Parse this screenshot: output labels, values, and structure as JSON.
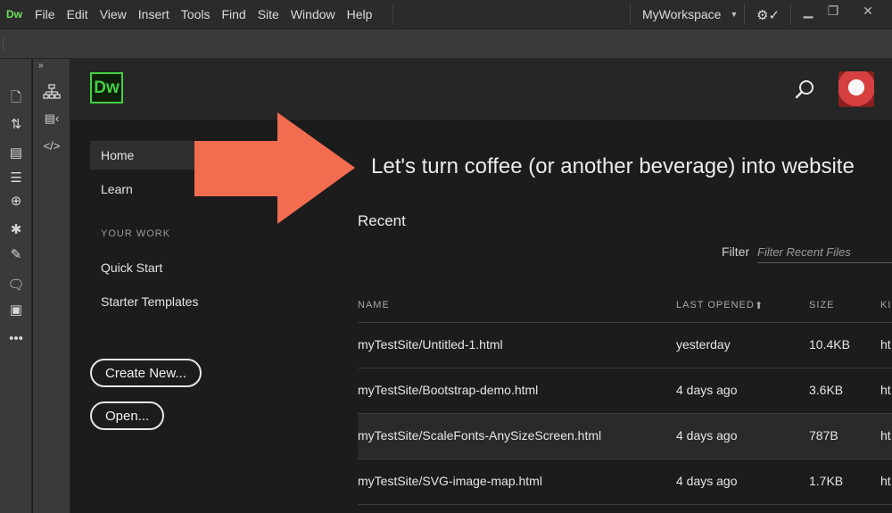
{
  "menubar": {
    "app_logo": "Dw",
    "items": [
      "File",
      "Edit",
      "View",
      "Insert",
      "Tools",
      "Find",
      "Site",
      "Window",
      "Help"
    ],
    "workspace": "MyWorkspace",
    "sync_icon": "gear-check-icon",
    "window_controls": [
      "minimize-icon",
      "restore-icon",
      "close-icon"
    ]
  },
  "left_tools": [
    "new-file-icon",
    "file-transfer-icon",
    "page-properties-icon",
    "format-source-icon",
    "target-icon",
    "wrap-tag-icon",
    "highlight-icon",
    "comment-icon",
    "preview-icon",
    "more-icon"
  ],
  "panel_tools": {
    "collapse": "»",
    "items": [
      "site-structure-icon",
      "code-inspector-icon",
      "code-view-icon"
    ]
  },
  "home": {
    "logo": "Dw",
    "nav": {
      "home": "Home",
      "learn": "Learn",
      "section": "YOUR WORK",
      "quick_start": "Quick Start",
      "starter_templates": "Starter Templates"
    },
    "create_new": "Create New...",
    "open": "Open...",
    "headline": "Let's turn coffee (or another beverage) into website",
    "recent_title": "Recent",
    "filter_label": "Filter",
    "filter_placeholder": "Filter Recent Files",
    "table": {
      "columns": [
        "NAME",
        "LAST OPENED",
        "SIZE",
        "KI"
      ],
      "sort_indicator": "⬆",
      "rows": [
        {
          "name": "myTestSite/Untitled-1.html",
          "opened": "yesterday",
          "size": "10.4KB",
          "kind": "ht"
        },
        {
          "name": "myTestSite/Bootstrap-demo.html",
          "opened": "4 days ago",
          "size": "3.6KB",
          "kind": "ht"
        },
        {
          "name": "myTestSite/ScaleFonts-AnySizeScreen.html",
          "opened": "4 days ago",
          "size": "787B",
          "kind": "ht"
        },
        {
          "name": "myTestSite/SVG-image-map.html",
          "opened": "4 days ago",
          "size": "1.7KB",
          "kind": "ht"
        }
      ]
    }
  },
  "overlay": {
    "arrow_color": "#f26d50"
  },
  "colors": {
    "accent_green": "#45d044",
    "background": "#1c1c1c"
  }
}
